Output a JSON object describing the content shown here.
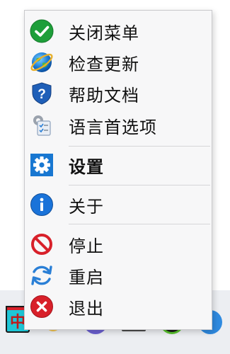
{
  "menu": {
    "items": [
      {
        "label": "关闭菜单",
        "icon": "check-circle-icon",
        "bold": false
      },
      {
        "label": "检查更新",
        "icon": "globe-update-icon",
        "bold": false
      },
      {
        "label": "帮助文档",
        "icon": "help-shield-icon",
        "bold": false
      },
      {
        "label": "语言首选项",
        "icon": "language-preferences-icon",
        "bold": false
      },
      {
        "label": "设置",
        "icon": "gear-icon",
        "bold": true
      },
      {
        "label": "关于",
        "icon": "info-icon",
        "bold": false
      },
      {
        "label": "停止",
        "icon": "stop-icon",
        "bold": false
      },
      {
        "label": "重启",
        "icon": "restart-icon",
        "bold": false
      },
      {
        "label": "退出",
        "icon": "exit-icon",
        "bold": false
      }
    ]
  },
  "taskbar": {
    "ime_glyph": "中"
  },
  "colors": {
    "check_green": "#1e9e3a",
    "help_blue": "#1f5fb8",
    "gear_blue": "#1877d1",
    "info_blue": "#1a73d9",
    "stop_red": "#d8202a",
    "restart_blue": "#2a7fd6",
    "exit_red": "#d8202a"
  }
}
